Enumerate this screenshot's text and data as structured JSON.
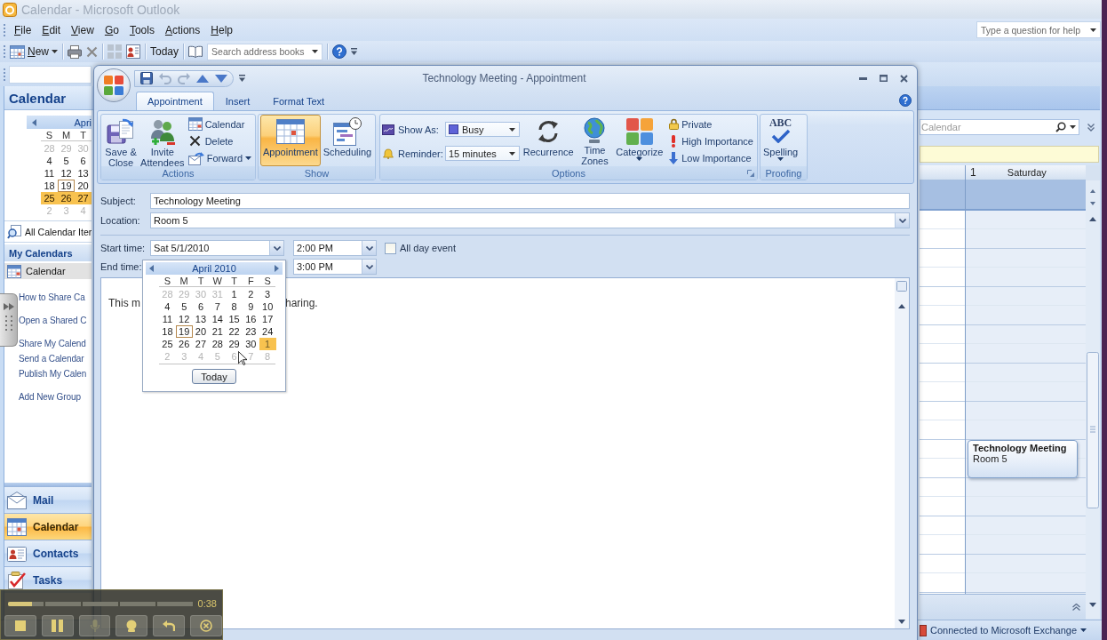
{
  "outlook": {
    "title": "Calendar - Microsoft Outlook",
    "menu": [
      "File",
      "Edit",
      "View",
      "Go",
      "Tools",
      "Actions",
      "Help"
    ],
    "help_search": {
      "placeholder": "Type a question for help"
    },
    "toolbar": {
      "new": "New",
      "today": "Today",
      "address_search": {
        "placeholder": "Search address books"
      }
    },
    "navigation": {
      "title": "Calendar",
      "mini_calendar": {
        "month": "Apri",
        "weekdays": [
          "S",
          "M",
          "T"
        ],
        "weeks": [
          [
            {
              "day": "28",
              "other_month": true,
              "today": false,
              "selected": false
            },
            {
              "day": "29",
              "other_month": true,
              "today": false,
              "selected": false
            },
            {
              "day": "30",
              "other_month": true,
              "today": false,
              "selected": false
            }
          ],
          [
            {
              "day": "4",
              "other_month": false,
              "today": false,
              "selected": false
            },
            {
              "day": "5",
              "other_month": false,
              "today": false,
              "selected": false
            },
            {
              "day": "6",
              "other_month": false,
              "today": false,
              "selected": false
            }
          ],
          [
            {
              "day": "11",
              "other_month": false,
              "today": false,
              "selected": false
            },
            {
              "day": "12",
              "other_month": false,
              "today": false,
              "selected": false
            },
            {
              "day": "13",
              "other_month": false,
              "today": false,
              "selected": false
            }
          ],
          [
            {
              "day": "18",
              "other_month": false,
              "today": false,
              "selected": false
            },
            {
              "day": "19",
              "other_month": false,
              "today": true,
              "selected": false
            },
            {
              "day": "20",
              "other_month": false,
              "today": false,
              "selected": false
            }
          ],
          [
            {
              "day": "25",
              "other_month": false,
              "today": false,
              "selected": true
            },
            {
              "day": "26",
              "other_month": false,
              "today": false,
              "selected": true
            },
            {
              "day": "27",
              "other_month": false,
              "today": false,
              "selected": true
            }
          ],
          [
            {
              "day": "2",
              "other_month": true,
              "today": false,
              "selected": false
            },
            {
              "day": "3",
              "other_month": true,
              "today": false,
              "selected": false
            },
            {
              "day": "4",
              "other_month": true,
              "today": false,
              "selected": false
            }
          ]
        ]
      },
      "all_items": "All Calendar Iter",
      "my_calendars": {
        "header": "My Calendars",
        "items": [
          {
            "label": "Calendar",
            "selected": true
          }
        ]
      },
      "link_groups": [
        [
          "How to Share Ca"
        ],
        [
          "Open a Shared C"
        ],
        [
          "Share My Calend",
          "Send a Calendar",
          "Publish My Calen"
        ],
        [
          "Add New Group"
        ]
      ],
      "modules": [
        {
          "label": "Mail",
          "selected": false
        },
        {
          "label": "Calendar",
          "selected": true
        },
        {
          "label": "Contacts",
          "selected": false
        },
        {
          "label": "Tasks",
          "selected": false
        }
      ]
    },
    "view": {
      "search": {
        "placeholder": "Calendar"
      },
      "day": {
        "number": "1",
        "weekday": "Saturday"
      },
      "appointments": [
        {
          "title": "Technology Meeting",
          "location": "Room 5"
        }
      ]
    },
    "status_bar": {
      "connection": "Connected to Microsoft Exchange"
    }
  },
  "appointment_window": {
    "title": "Technology Meeting - Appointment",
    "tabs": [
      {
        "label": "Appointment",
        "selected": true
      },
      {
        "label": "Insert",
        "selected": false
      },
      {
        "label": "Format Text",
        "selected": false
      }
    ],
    "ribbon": {
      "actions": {
        "label": "Actions",
        "save_close": "Save & Close",
        "invite_attendees": "Invite Attendees",
        "calendar": "Calendar",
        "delete": "Delete",
        "forward": "Forward"
      },
      "show": {
        "label": "Show",
        "buttons": [
          {
            "label": "Appointment",
            "selected": true
          },
          {
            "label": "Scheduling",
            "selected": false
          }
        ]
      },
      "options": {
        "label": "Options",
        "show_as": {
          "label": "Show As:",
          "value": "Busy"
        },
        "reminder": {
          "label": "Reminder:",
          "value": "15 minutes"
        },
        "recurrence": "Recurrence",
        "time_zones": "Time Zones",
        "categorize": "Categorize",
        "private": "Private",
        "high_importance": "High Importance",
        "low_importance": "Low Importance"
      },
      "proofing": {
        "label": "Proofing",
        "spelling_glyph": "ABC",
        "spelling": "Spelling"
      }
    },
    "form": {
      "subject": {
        "label": "Subject:",
        "value": "Technology Meeting"
      },
      "location": {
        "label": "Location:",
        "value": "Room 5"
      },
      "start": {
        "label": "Start time:",
        "date": "Sat 5/1/2010",
        "time": "2:00 PM"
      },
      "all_day": {
        "label": "All day event",
        "checked": false
      },
      "end": {
        "label": "End time:",
        "time": "3:00 PM"
      },
      "body": [
        "This m",
        "haring."
      ]
    },
    "date_picker": {
      "month": "April 2010",
      "weekdays": [
        "S",
        "M",
        "T",
        "W",
        "T",
        "F",
        "S"
      ],
      "weeks": [
        [
          {
            "day": "28",
            "other_month": true,
            "today": false,
            "selected": false
          },
          {
            "day": "29",
            "other_month": true,
            "today": false,
            "selected": false
          },
          {
            "day": "30",
            "other_month": true,
            "today": false,
            "selected": false
          },
          {
            "day": "31",
            "other_month": true,
            "today": false,
            "selected": false
          },
          {
            "day": "1",
            "other_month": false,
            "today": false,
            "selected": false
          },
          {
            "day": "2",
            "other_month": false,
            "today": false,
            "selected": false
          },
          {
            "day": "3",
            "other_month": false,
            "today": false,
            "selected": false
          }
        ],
        [
          {
            "day": "4",
            "other_month": false,
            "today": false,
            "selected": false
          },
          {
            "day": "5",
            "other_month": false,
            "today": false,
            "selected": false
          },
          {
            "day": "6",
            "other_month": false,
            "today": false,
            "selected": false
          },
          {
            "day": "7",
            "other_month": false,
            "today": false,
            "selected": false
          },
          {
            "day": "8",
            "other_month": false,
            "today": false,
            "selected": false
          },
          {
            "day": "9",
            "other_month": false,
            "today": false,
            "selected": false
          },
          {
            "day": "10",
            "other_month": false,
            "today": false,
            "selected": false
          }
        ],
        [
          {
            "day": "11",
            "other_month": false,
            "today": false,
            "selected": false
          },
          {
            "day": "12",
            "other_month": false,
            "today": false,
            "selected": false
          },
          {
            "day": "13",
            "other_month": false,
            "today": false,
            "selected": false
          },
          {
            "day": "14",
            "other_month": false,
            "today": false,
            "selected": false
          },
          {
            "day": "15",
            "other_month": false,
            "today": false,
            "selected": false
          },
          {
            "day": "16",
            "other_month": false,
            "today": false,
            "selected": false
          },
          {
            "day": "17",
            "other_month": false,
            "today": false,
            "selected": false
          }
        ],
        [
          {
            "day": "18",
            "other_month": false,
            "today": false,
            "selected": false
          },
          {
            "day": "19",
            "other_month": false,
            "today": true,
            "selected": false
          },
          {
            "day": "20",
            "other_month": false,
            "today": false,
            "selected": false
          },
          {
            "day": "21",
            "other_month": false,
            "today": false,
            "selected": false
          },
          {
            "day": "22",
            "other_month": false,
            "today": false,
            "selected": false
          },
          {
            "day": "23",
            "other_month": false,
            "today": false,
            "selected": false
          },
          {
            "day": "24",
            "other_month": false,
            "today": false,
            "selected": false
          }
        ],
        [
          {
            "day": "25",
            "other_month": false,
            "today": false,
            "selected": false
          },
          {
            "day": "26",
            "other_month": false,
            "today": false,
            "selected": false
          },
          {
            "day": "27",
            "other_month": false,
            "today": false,
            "selected": false
          },
          {
            "day": "28",
            "other_month": false,
            "today": false,
            "selected": false
          },
          {
            "day": "29",
            "other_month": false,
            "today": false,
            "selected": false
          },
          {
            "day": "30",
            "other_month": false,
            "today": false,
            "selected": false
          },
          {
            "day": "1",
            "other_month": true,
            "today": false,
            "selected": true
          }
        ],
        [
          {
            "day": "2",
            "other_month": true,
            "today": false,
            "selected": false
          },
          {
            "day": "3",
            "other_month": true,
            "today": false,
            "selected": false
          },
          {
            "day": "4",
            "other_month": true,
            "today": false,
            "selected": false
          },
          {
            "day": "5",
            "other_month": true,
            "today": false,
            "selected": false
          },
          {
            "day": "6",
            "other_month": true,
            "today": false,
            "selected": false
          },
          {
            "day": "7",
            "other_month": true,
            "today": false,
            "selected": false
          },
          {
            "day": "8",
            "other_month": true,
            "today": false,
            "selected": false
          }
        ]
      ],
      "today_button": "Today"
    }
  },
  "player": {
    "time": "0:38",
    "level": 0.13
  }
}
